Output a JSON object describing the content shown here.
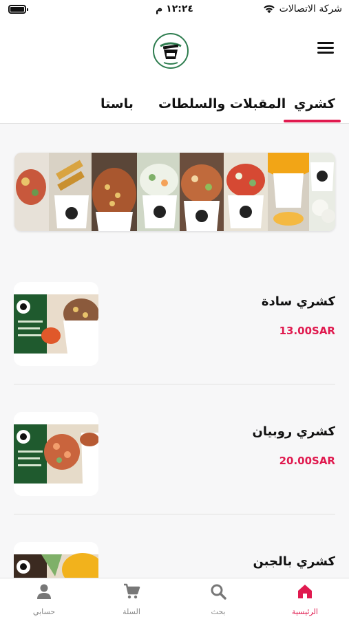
{
  "status_bar": {
    "carrier": "شركة الاتصالات",
    "time": "١٢:٢٤ م"
  },
  "header": {
    "logo_icon": "koshary-bowl-logo",
    "menu_icon": "hamburger-menu-icon"
  },
  "tabs": [
    {
      "label": "كشري",
      "active": true
    },
    {
      "label": "المقبلات والسلطات",
      "active": false
    },
    {
      "label": "باستا",
      "active": false
    }
  ],
  "colors": {
    "accent": "#e01a4f",
    "brand_green": "#2e7d4f"
  },
  "menu_items": [
    {
      "name": "كشري سادة",
      "price": "13.00SAR"
    },
    {
      "name": "كشري روبيان",
      "price": "20.00SAR"
    },
    {
      "name": "كشري بالجبن",
      "price": ""
    }
  ],
  "bottom_nav": [
    {
      "label": "الرئيسية",
      "icon": "home-icon",
      "active": true
    },
    {
      "label": "بحث",
      "icon": "search-icon",
      "active": false
    },
    {
      "label": "السلة",
      "icon": "cart-icon",
      "active": false
    },
    {
      "label": "حسابي",
      "icon": "user-icon",
      "active": false
    }
  ]
}
